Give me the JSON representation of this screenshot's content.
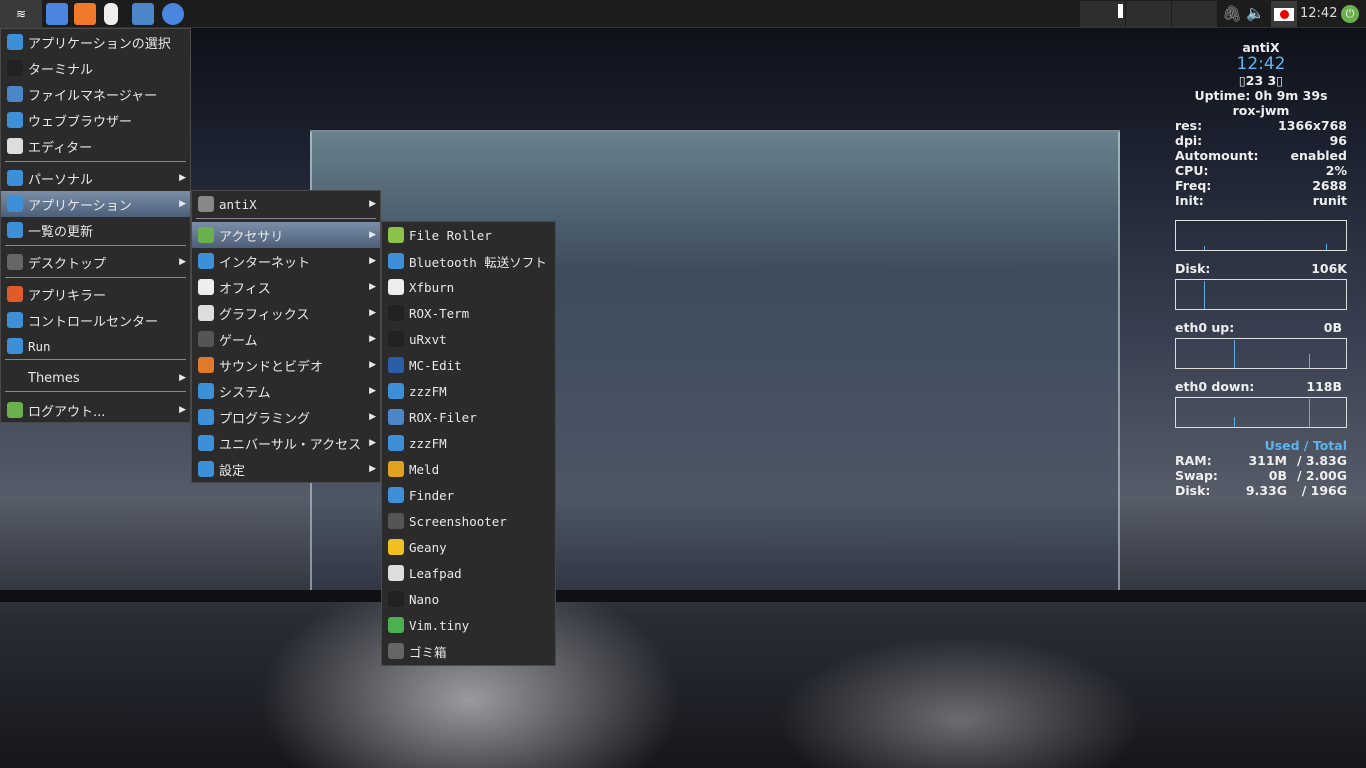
{
  "taskbar": {
    "clock": "12:42",
    "icons": [
      "antix-menu-icon",
      "email-icon",
      "update-icon",
      "usb-icon",
      "file-manager-icon",
      "browser-icon"
    ]
  },
  "main_menu": [
    {
      "label": "アプリケーションの選択",
      "icon": "search-icon",
      "color": "#3d8fd8"
    },
    {
      "label": "ターミナル",
      "icon": "terminal-icon",
      "color": "#222"
    },
    {
      "label": "ファイルマネージャー",
      "icon": "folder-icon",
      "color": "#4a86c8"
    },
    {
      "label": "ウェブブラウザー",
      "icon": "browser-icon",
      "color": "#3d8fd8"
    },
    {
      "label": "エディター",
      "icon": "editor-icon",
      "color": "#ddd"
    },
    {
      "label": "パーソナル",
      "icon": "person-icon",
      "color": "#3d8fd8",
      "sub": true
    },
    {
      "label": "アプリケーション",
      "icon": "apps-icon",
      "color": "#3d8fd8",
      "sub": true
    },
    {
      "label": "一覧の更新",
      "icon": "refresh-icon",
      "color": "#3d8fd8"
    },
    {
      "label": "デスクトップ",
      "icon": "desktop-icon",
      "color": "#666",
      "sub": true
    },
    {
      "label": "アプリキラー",
      "icon": "kill-icon",
      "color": "#e05a2a"
    },
    {
      "label": "コントロールセンター",
      "icon": "control-center-icon",
      "color": "#3d8fd8"
    },
    {
      "label": "Run",
      "icon": "run-icon",
      "color": "#3d8fd8"
    },
    {
      "label": "Themes",
      "icon": "",
      "color": "",
      "sub": true
    },
    {
      "label": "ログアウト...",
      "icon": "logout-icon",
      "color": "#6ab04c",
      "sub": true
    }
  ],
  "apps_menu": [
    {
      "label": "antiX",
      "icon": "antix-icon",
      "color": "#888"
    },
    {
      "label": "アクセサリ",
      "icon": "accessories-icon",
      "color": "#6ab04c"
    },
    {
      "label": "インターネット",
      "icon": "internet-icon",
      "color": "#3d8fd8"
    },
    {
      "label": "オフィス",
      "icon": "office-icon",
      "color": "#eee"
    },
    {
      "label": "グラフィックス",
      "icon": "graphics-icon",
      "color": "#ddd"
    },
    {
      "label": "ゲーム",
      "icon": "games-icon",
      "color": "#555"
    },
    {
      "label": "サウンドとビデオ",
      "icon": "multimedia-icon",
      "color": "#e07a2a"
    },
    {
      "label": "システム",
      "icon": "system-icon",
      "color": "#3d8fd8"
    },
    {
      "label": "プログラミング",
      "icon": "programming-icon",
      "color": "#3d8fd8"
    },
    {
      "label": "ユニバーサル・アクセス",
      "icon": "accessibility-icon",
      "color": "#3d8fd8"
    },
    {
      "label": "設定",
      "icon": "settings-icon",
      "color": "#3d8fd8"
    }
  ],
  "accessories_menu": [
    {
      "label": "File Roller",
      "icon": "archive-icon",
      "color": "#8bc34a"
    },
    {
      "label": "Bluetooth 転送ソフト",
      "icon": "bluetooth-icon",
      "color": "#3d8fd8"
    },
    {
      "label": "Xfburn",
      "icon": "disc-icon",
      "color": "#eee"
    },
    {
      "label": "ROX-Term",
      "icon": "terminal-icon",
      "color": "#222"
    },
    {
      "label": "uRxvt",
      "icon": "terminal-icon",
      "color": "#222"
    },
    {
      "label": "MC-Edit",
      "icon": "mc-icon",
      "color": "#2a5fa8"
    },
    {
      "label": "zzzFM",
      "icon": "zzzfm-icon",
      "color": "#3d8fd8"
    },
    {
      "label": "ROX-Filer",
      "icon": "rox-filer-icon",
      "color": "#4a86c8"
    },
    {
      "label": "zzzFM",
      "icon": "zzzfm-icon",
      "color": "#3d8fd8"
    },
    {
      "label": "Meld",
      "icon": "meld-icon",
      "color": "#e0a020"
    },
    {
      "label": "Finder",
      "icon": "search-icon",
      "color": "#3d8fd8"
    },
    {
      "label": "Screenshooter",
      "icon": "screenshot-icon",
      "color": "#555"
    },
    {
      "label": "Geany",
      "icon": "geany-icon",
      "color": "#f0c020"
    },
    {
      "label": "Leafpad",
      "icon": "editor-icon",
      "color": "#ddd"
    },
    {
      "label": "Nano",
      "icon": "terminal-icon",
      "color": "#222"
    },
    {
      "label": "Vim.tiny",
      "icon": "vim-icon",
      "color": "#4caf50"
    },
    {
      "label": "ゴミ箱",
      "icon": "trash-icon",
      "color": "#666"
    }
  ],
  "conky": {
    "host": "antiX",
    "time": "12:42",
    "date": "▯23 3▯",
    "uptime": "Uptime: 0h 9m 39s",
    "wm": "rox-jwm",
    "rows": [
      [
        "res:",
        "1366x768"
      ],
      [
        "dpi:",
        "96"
      ],
      [
        "Automount:",
        "enabled"
      ],
      [
        "CPU:",
        "2%"
      ],
      [
        "Freq:",
        "2688"
      ],
      [
        "Init:",
        "runit"
      ]
    ],
    "disk_label": "Disk:",
    "disk_val": "106K",
    "up_label": "eth0 up:",
    "up_val": "0B",
    "down_label": "eth0 down:",
    "down_val": "118B",
    "used_total": "Used / Total",
    "mem": [
      [
        "RAM:",
        "311M",
        "/ 3.83G"
      ],
      [
        "Swap:",
        "0B",
        "/ 2.00G"
      ],
      [
        "Disk:",
        "9.33G",
        "/ 196G"
      ]
    ]
  }
}
